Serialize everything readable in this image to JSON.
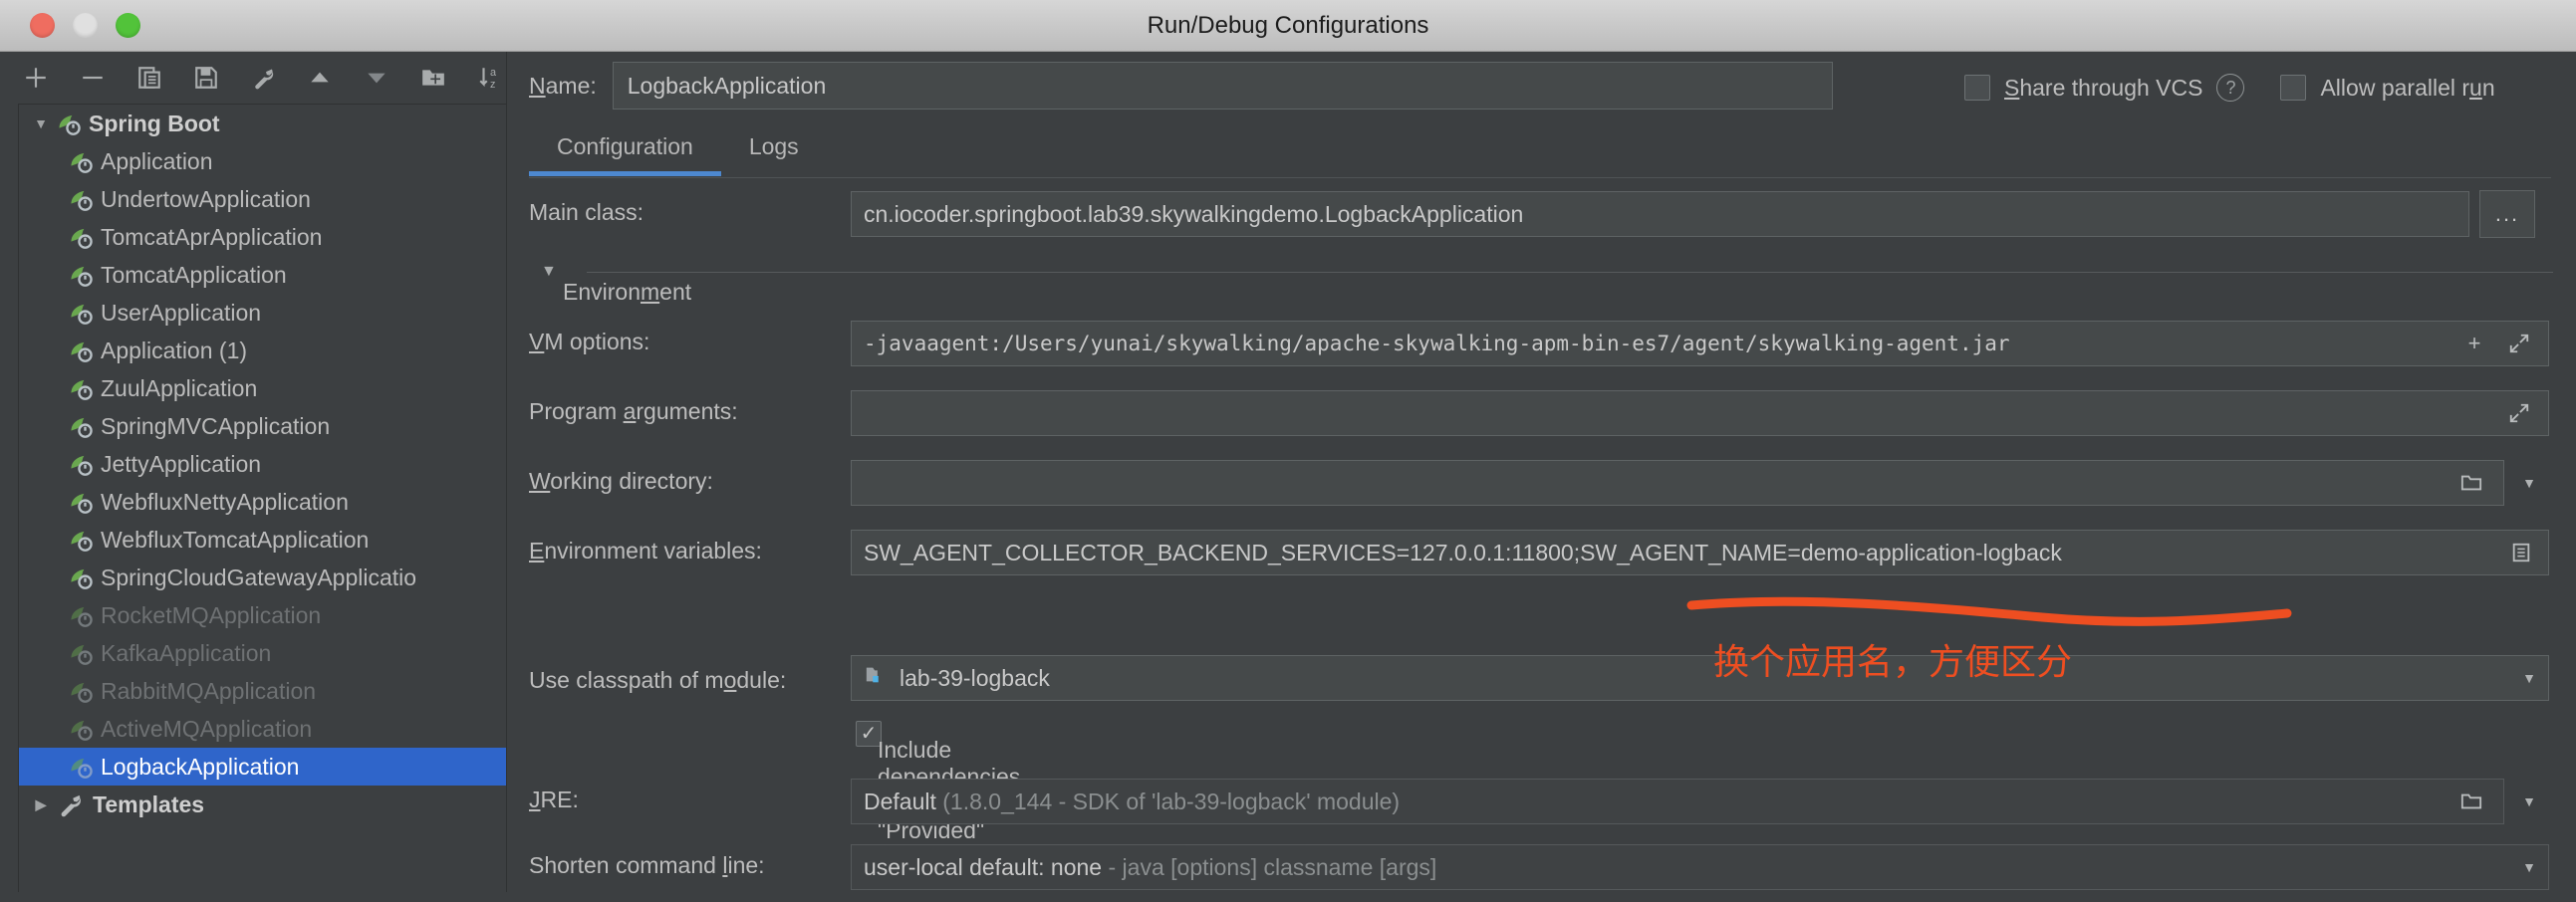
{
  "window": {
    "title": "Run/Debug Configurations",
    "traffic_lights": [
      "close-button",
      "minimize-button",
      "zoom-button"
    ]
  },
  "toolbar": {
    "icons": [
      {
        "name": "add-icon",
        "glyph": "plus"
      },
      {
        "name": "remove-icon",
        "glyph": "minus"
      },
      {
        "name": "copy-configuration-icon",
        "glyph": "copy"
      },
      {
        "name": "save-configuration-icon",
        "glyph": "save"
      },
      {
        "name": "edit-templates-icon",
        "glyph": "wrench"
      },
      {
        "name": "move-up-icon",
        "glyph": "triangle-up"
      },
      {
        "name": "move-down-icon",
        "glyph": "triangle-down"
      },
      {
        "name": "new-folder-icon",
        "glyph": "folder-plus"
      },
      {
        "name": "sort-alphabetically-icon",
        "glyph": "sort-az"
      }
    ]
  },
  "tree": {
    "nodes": [
      {
        "label": "Spring Boot",
        "level": 0,
        "expanded": true,
        "icon": "spring-boot-icon",
        "state": "bold"
      },
      {
        "label": "Application",
        "level": 1,
        "icon": "spring-boot-icon",
        "state": "normal"
      },
      {
        "label": "UndertowApplication",
        "level": 1,
        "icon": "spring-boot-icon",
        "state": "normal"
      },
      {
        "label": "TomcatAprApplication",
        "level": 1,
        "icon": "spring-boot-icon",
        "state": "normal"
      },
      {
        "label": "TomcatApplication",
        "level": 1,
        "icon": "spring-boot-icon",
        "state": "normal"
      },
      {
        "label": "UserApplication",
        "level": 1,
        "icon": "spring-boot-icon",
        "state": "normal"
      },
      {
        "label": "Application (1)",
        "level": 1,
        "icon": "spring-boot-icon",
        "state": "normal"
      },
      {
        "label": "ZuulApplication",
        "level": 1,
        "icon": "spring-boot-icon",
        "state": "normal"
      },
      {
        "label": "SpringMVCApplication",
        "level": 1,
        "icon": "spring-boot-icon",
        "state": "normal"
      },
      {
        "label": "JettyApplication",
        "level": 1,
        "icon": "spring-boot-icon",
        "state": "normal"
      },
      {
        "label": "WebfluxNettyApplication",
        "level": 1,
        "icon": "spring-boot-icon",
        "state": "normal"
      },
      {
        "label": "WebfluxTomcatApplication",
        "level": 1,
        "icon": "spring-boot-icon",
        "state": "normal"
      },
      {
        "label": "SpringCloudGatewayApplicatio",
        "level": 1,
        "icon": "spring-boot-icon",
        "state": "normal"
      },
      {
        "label": "RocketMQApplication",
        "level": 1,
        "icon": "spring-boot-icon",
        "state": "dim"
      },
      {
        "label": "KafkaApplication",
        "level": 1,
        "icon": "spring-boot-icon",
        "state": "dim"
      },
      {
        "label": "RabbitMQApplication",
        "level": 1,
        "icon": "spring-boot-icon",
        "state": "dim"
      },
      {
        "label": "ActiveMQApplication",
        "level": 1,
        "icon": "spring-boot-icon",
        "state": "dim"
      },
      {
        "label": "LogbackApplication",
        "level": 1,
        "icon": "spring-boot-icon",
        "state": "selected"
      },
      {
        "label": "Templates",
        "level": 0,
        "expanded": false,
        "icon": "wrench-icon",
        "state": "bold"
      }
    ]
  },
  "header": {
    "name_label": "Name:",
    "name_mnemonic": "N",
    "name_value": "LogbackApplication",
    "share_vcs_label": "Share through VCS",
    "share_vcs_mnemonic": "S",
    "share_vcs_checked": false,
    "help_glyph": "?",
    "allow_parallel_label": "Allow parallel run",
    "allow_parallel_checked": false
  },
  "tabs": [
    {
      "label": "Configuration",
      "active": true
    },
    {
      "label": "Logs",
      "active": false
    }
  ],
  "fields": {
    "main_class": {
      "label": "Main class:",
      "value": "cn.iocoder.springboot.lab39.skywalkingdemo.LogbackApplication",
      "browse_label": "..."
    },
    "environment_section": {
      "label": "Environment",
      "mnemonic": "m",
      "expanded": true
    },
    "vm_options": {
      "label": "VM options:",
      "mnemonic": "V",
      "value": "-javaagent:/Users/yunai/skywalking/apache-skywalking-apm-bin-es7/agent/skywalking-agent.jar",
      "add_glyph": "+",
      "expand_glyph": "expand-icon"
    },
    "program_arguments": {
      "label": "Program arguments:",
      "mnemonic": "a",
      "value": "",
      "expand_glyph": "expand-icon"
    },
    "working_directory": {
      "label": "Working directory:",
      "mnemonic": "W",
      "value": "",
      "browse_glyph": "folder-icon",
      "dropdown_glyph": "chevron-down-icon"
    },
    "environment_variables": {
      "label": "Environment variables:",
      "mnemonic": "E",
      "value": "SW_AGENT_COLLECTOR_BACKEND_SERVICES=127.0.0.1:11800;SW_AGENT_NAME=demo-application-logback",
      "browse_glyph": "list-icon"
    },
    "use_classpath_of_module": {
      "label": "Use classpath of module:",
      "mnemonic": "o",
      "value": "lab-39-logback",
      "icon": "module-icon",
      "dropdown_glyph": "chevron-down-icon"
    },
    "include_dependencies": {
      "label": "Include dependencies with \"Provided\" scope",
      "checked": true,
      "check_glyph": "✓"
    },
    "jre": {
      "label": "JRE:",
      "mnemonic": "J",
      "value": "Default",
      "value_suffix": "(1.8.0_144 - SDK of 'lab-39-logback' module)",
      "browse_glyph": "folder-icon",
      "dropdown_glyph": "chevron-down-icon"
    },
    "shorten_command_line": {
      "label": "Shorten command line:",
      "mnemonic": "l",
      "value": "user-local default: none",
      "value_suffix": "- java [options] classname [args]",
      "dropdown_glyph": "chevron-down-icon"
    }
  },
  "annotation": {
    "text": "换个应用名，方便区分",
    "color": "#ee4e21",
    "underline": "hand-drawn-line"
  },
  "colors": {
    "background": "#3c3f41",
    "field_background": "#45494a",
    "accent_blue": "#4d88cf",
    "selection_blue": "#2f65ca",
    "text": "#bbbbbb",
    "dim_text": "#6e7173",
    "spring_green": "#6aa84f",
    "annotation_red": "#ee4e21"
  }
}
